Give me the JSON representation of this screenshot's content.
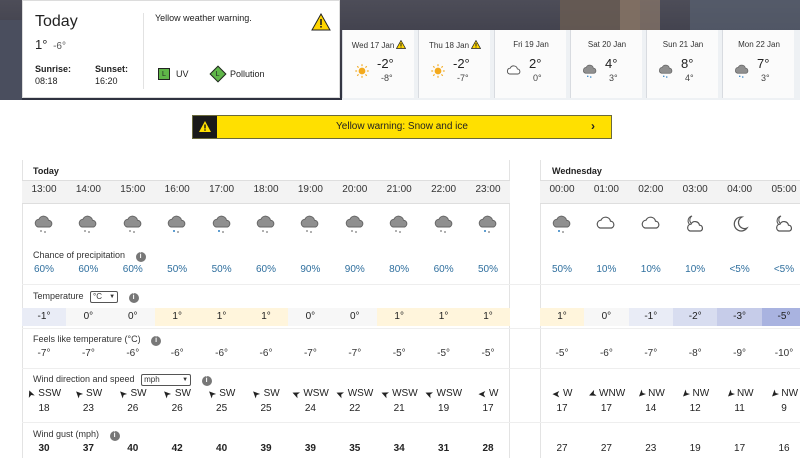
{
  "today": {
    "title": "Today",
    "high": "1°",
    "low": "-6°",
    "sunrise_label": "Sunrise:",
    "sunrise": "08:18",
    "sunset_label": "Sunset:",
    "sunset": "16:20",
    "warning_text": "Yellow weather warning.",
    "uv_badge": "L",
    "uv_label": "UV",
    "pollution_badge": "L",
    "pollution_label": "Pollution"
  },
  "days": [
    {
      "name": "Wed 17 Jan",
      "warning": true,
      "icon": "sun-icon",
      "high": "-2°",
      "low": "-8°"
    },
    {
      "name": "Thu 18 Jan",
      "warning": true,
      "icon": "sun-icon",
      "high": "-2°",
      "low": "-7°"
    },
    {
      "name": "Fri 19 Jan",
      "warning": false,
      "icon": "cloud-icon",
      "high": "2°",
      "low": "0°"
    },
    {
      "name": "Sat 20 Jan",
      "warning": false,
      "icon": "rain-cloud-icon",
      "high": "4°",
      "low": "3°"
    },
    {
      "name": "Sun 21 Jan",
      "warning": false,
      "icon": "rain-cloud-icon",
      "high": "8°",
      "low": "4°"
    },
    {
      "name": "Mon 22 Jan",
      "warning": false,
      "icon": "rain-cloud-icon",
      "high": "7°",
      "low": "3°"
    }
  ],
  "warning_banner": {
    "text": "Yellow warning: Snow and ice",
    "chevron": "›"
  },
  "hourly": {
    "day1": "Today",
    "day2": "Wednesday",
    "labels": {
      "precip": "Chance of precipitation",
      "temp": "Temperature",
      "temp_unit": "°C",
      "feels": "Feels like temperature (°C)",
      "wind": "Wind direction and speed",
      "wind_unit": "mph",
      "gust": "Wind gust (mph)",
      "info": "i"
    },
    "hours": [
      {
        "time": "13:00",
        "icon": "snow-cloud-icon",
        "precip": "60%",
        "temp": "-1°",
        "feels": "-7°",
        "dir": "SSW",
        "speed": "18",
        "gust": "30"
      },
      {
        "time": "14:00",
        "icon": "snow-cloud-icon",
        "precip": "60%",
        "temp": "0°",
        "feels": "-7°",
        "dir": "SW",
        "speed": "23",
        "gust": "37"
      },
      {
        "time": "15:00",
        "icon": "snow-cloud-icon",
        "precip": "60%",
        "temp": "0°",
        "feels": "-6°",
        "dir": "SW",
        "speed": "26",
        "gust": "40"
      },
      {
        "time": "16:00",
        "icon": "sleet-cloud-icon",
        "precip": "50%",
        "temp": "1°",
        "feels": "-6°",
        "dir": "SW",
        "speed": "26",
        "gust": "42"
      },
      {
        "time": "17:00",
        "icon": "sleet-cloud-icon",
        "precip": "50%",
        "temp": "1°",
        "feels": "-6°",
        "dir": "SW",
        "speed": "25",
        "gust": "40"
      },
      {
        "time": "18:00",
        "icon": "snow-cloud-icon",
        "precip": "60%",
        "temp": "1°",
        "feels": "-6°",
        "dir": "SW",
        "speed": "25",
        "gust": "39"
      },
      {
        "time": "19:00",
        "icon": "snow-cloud-icon",
        "precip": "90%",
        "temp": "0°",
        "feels": "-7°",
        "dir": "WSW",
        "speed": "24",
        "gust": "39"
      },
      {
        "time": "20:00",
        "icon": "snow-cloud-icon",
        "precip": "90%",
        "temp": "0°",
        "feels": "-7°",
        "dir": "WSW",
        "speed": "22",
        "gust": "35"
      },
      {
        "time": "21:00",
        "icon": "snow-cloud-icon",
        "precip": "80%",
        "temp": "1°",
        "feels": "-5°",
        "dir": "WSW",
        "speed": "21",
        "gust": "34"
      },
      {
        "time": "22:00",
        "icon": "snow-cloud-icon",
        "precip": "60%",
        "temp": "1°",
        "feels": "-5°",
        "dir": "WSW",
        "speed": "19",
        "gust": "31"
      },
      {
        "time": "23:00",
        "icon": "sleet-cloud-icon",
        "precip": "50%",
        "temp": "1°",
        "feels": "-5°",
        "dir": "W",
        "speed": "17",
        "gust": "28"
      }
    ],
    "hours2": [
      {
        "time": "00:00",
        "icon": "sleet-cloud-icon",
        "precip": "50%",
        "temp": "1°",
        "feels": "-5°",
        "dir": "W",
        "speed": "17",
        "gust": "27"
      },
      {
        "time": "01:00",
        "icon": "cloud-icon",
        "precip": "10%",
        "temp": "0°",
        "feels": "-6°",
        "dir": "WNW",
        "speed": "17",
        "gust": "27"
      },
      {
        "time": "02:00",
        "icon": "cloud-icon",
        "precip": "10%",
        "temp": "-1°",
        "feels": "-7°",
        "dir": "NW",
        "speed": "14",
        "gust": "23"
      },
      {
        "time": "03:00",
        "icon": "partly-cloudy-night-icon",
        "precip": "10%",
        "temp": "-2°",
        "feels": "-8°",
        "dir": "NW",
        "speed": "12",
        "gust": "19"
      },
      {
        "time": "04:00",
        "icon": "moon-icon",
        "precip": "<5%",
        "temp": "-3°",
        "feels": "-9°",
        "dir": "NW",
        "speed": "11",
        "gust": "17"
      },
      {
        "time": "05:00",
        "icon": "partly-cloudy-night-icon",
        "precip": "<5%",
        "temp": "-5°",
        "feels": "-10°",
        "dir": "NW",
        "speed": "9",
        "gust": "16"
      }
    ]
  }
}
